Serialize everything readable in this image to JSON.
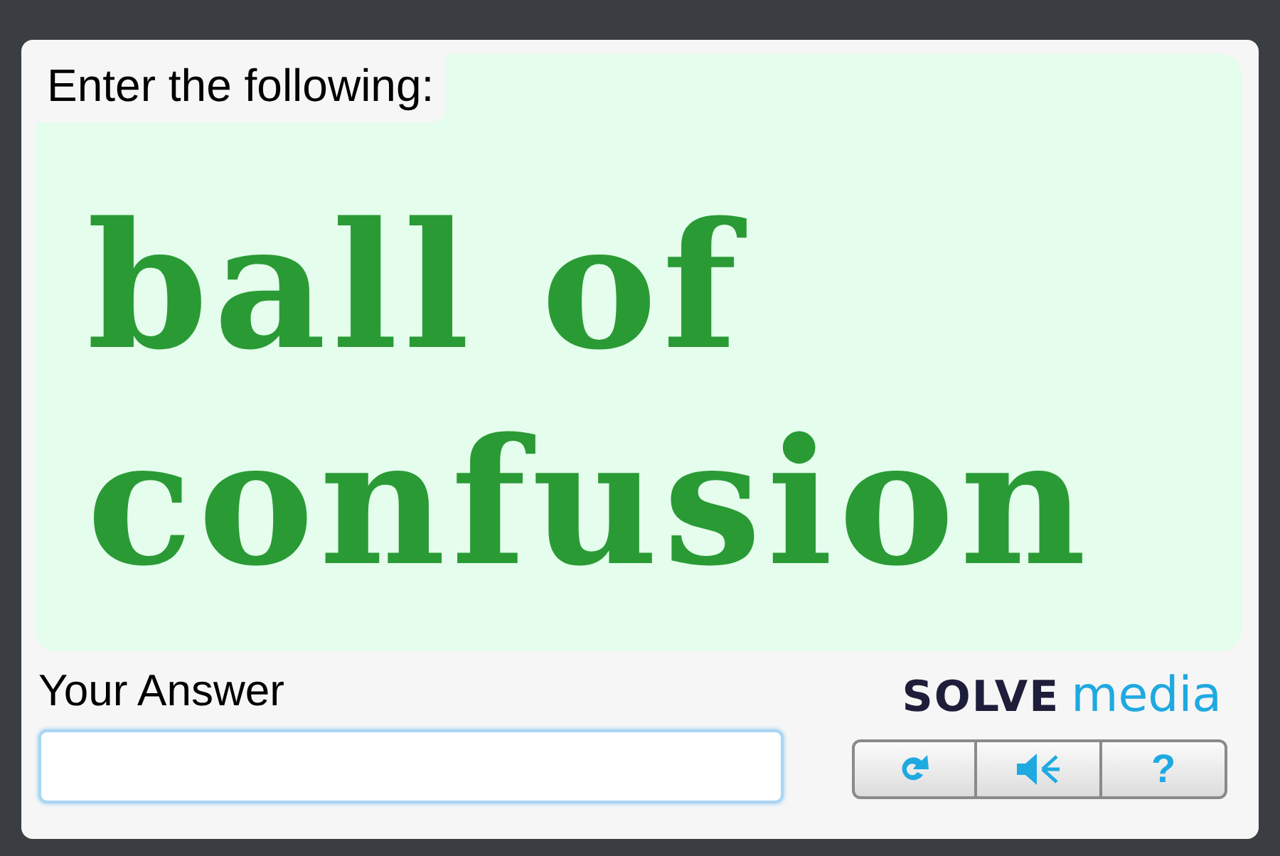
{
  "prompt": "Enter the following:",
  "challenge_lines": [
    "ball of",
    "confusion"
  ],
  "answer": {
    "label": "Your Answer"
  },
  "logo": {
    "word_1": "SOLVE",
    "word_2": "media"
  },
  "buttons": [
    {
      "kind": "reload"
    },
    {
      "kind": "audio"
    },
    {
      "kind": "help",
      "text": "?"
    }
  ]
}
